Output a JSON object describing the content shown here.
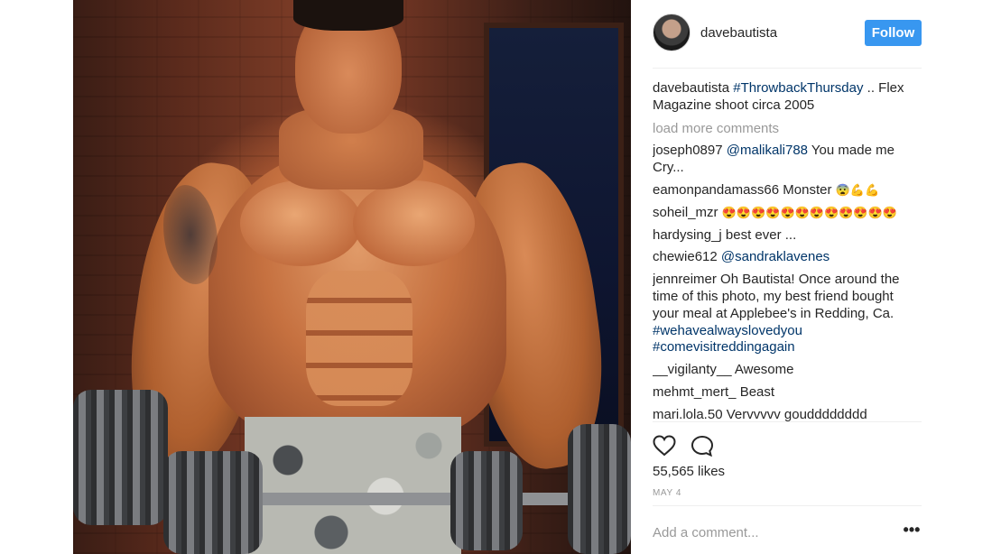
{
  "post": {
    "username": "davebautista",
    "follow_label": "Follow",
    "caption": {
      "user": "davebautista",
      "hashtag": "#ThrowbackThursday",
      "text": " .. Flex Magazine shoot circa 2005"
    },
    "load_more_label": "load more comments",
    "likes": "55,565 likes",
    "date": "MAY 4",
    "add_comment_placeholder": "Add a comment...",
    "more_icon": "more-options-icon"
  },
  "comments": [
    {
      "user": "joseph0897",
      "mention": "@malikali788",
      "text": " You made me Cry..."
    },
    {
      "user": "eamonpandamass66",
      "text": " Monster ",
      "emoji": "😨💪💪"
    },
    {
      "user": "soheil_mzr",
      "text": " ",
      "emoji": "😍😍😍😍😍😍😍😍😍😍😍😍"
    },
    {
      "user": "hardysing_j",
      "text": " best ever ..."
    },
    {
      "user": "chewie612",
      "mention": "@sandraklavenes",
      "text": ""
    },
    {
      "user": "jennreimer",
      "text": " Oh Bautista! Once around the time of this photo, my best friend bought your meal at Applebee's in Redding, Ca. ",
      "tags": [
        "#wehavealwayslovedyou",
        "#comevisitreddingagain"
      ]
    },
    {
      "user": "__vigilanty__",
      "text": " Awesome"
    },
    {
      "user": "mehmt_mert_",
      "text": " Beast"
    },
    {
      "user": "mari.lola.50",
      "text": " Vervvvvv goudddddddd"
    }
  ],
  "icons": {
    "like": "heart-outline-icon",
    "comment": "speech-bubble-icon",
    "avatar": "profile-avatar"
  },
  "colors": {
    "follow_button": "#3897f0",
    "link": "#003569",
    "muted": "#999999",
    "text": "#262626"
  }
}
